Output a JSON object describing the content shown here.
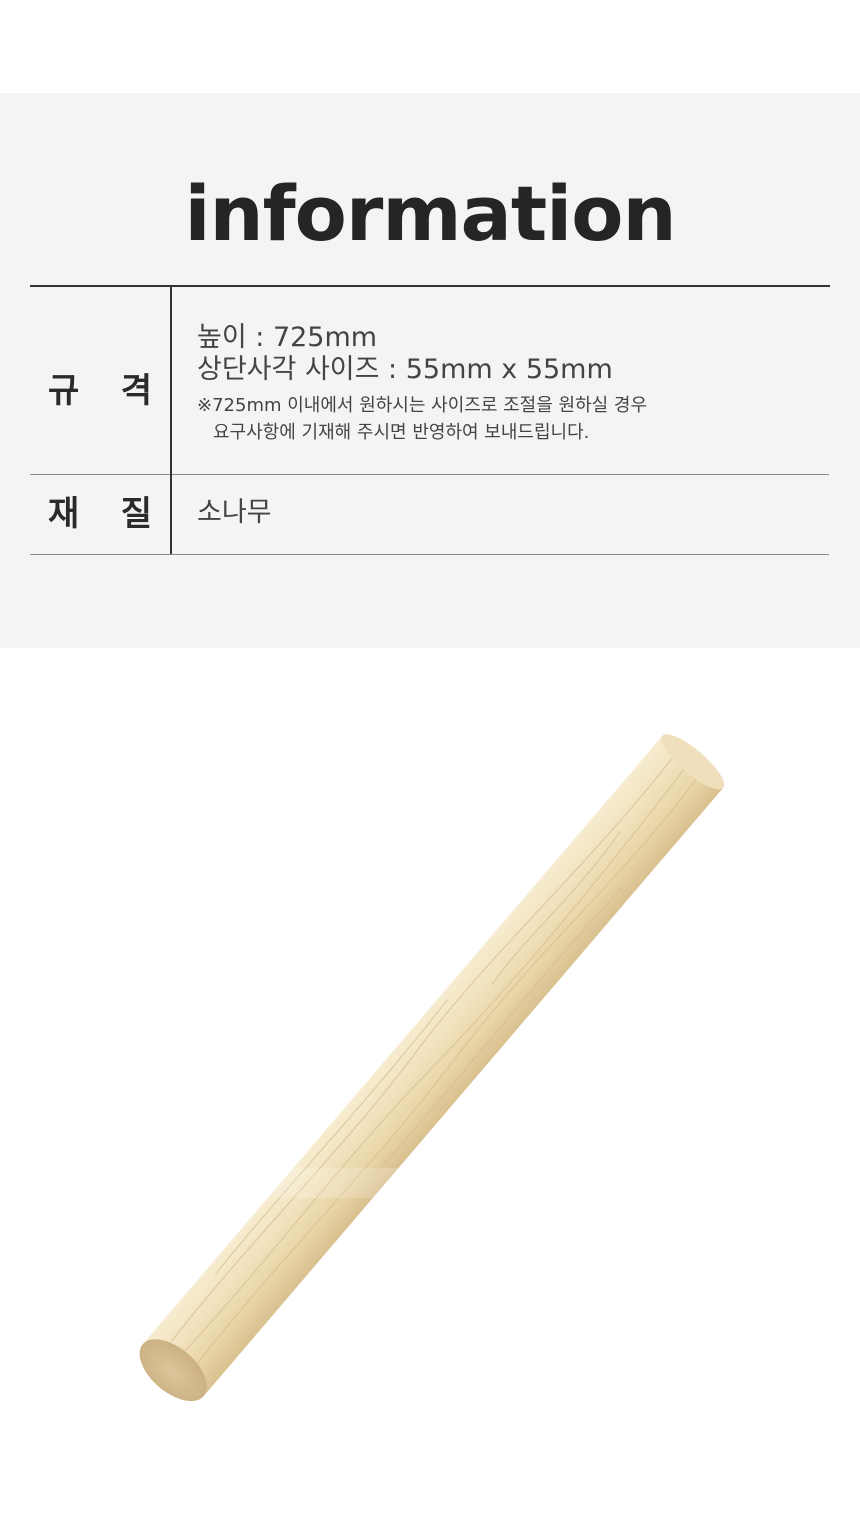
{
  "header": {
    "title": "information"
  },
  "spec": {
    "label": [
      "규",
      "격"
    ],
    "height_line": "높이 : 725mm",
    "size_line": "상단사각 사이즈 : 55mm x 55mm",
    "note_line1": "※725mm 이내에서 원하시는 사이즈로 조절을 원하실 경우",
    "note_line2": "요구사항에 기재해 주시면 반영하여 보내드립니다."
  },
  "material": {
    "label": [
      "재",
      "질"
    ],
    "value": "소나무"
  },
  "colors": {
    "panel_bg": "#f4f4f4",
    "wood_light": "#f3e6c4",
    "wood_mid": "#e6d2a2",
    "wood_end": "#d8c096"
  },
  "image": {
    "subject": "wooden-dowel-icon"
  }
}
